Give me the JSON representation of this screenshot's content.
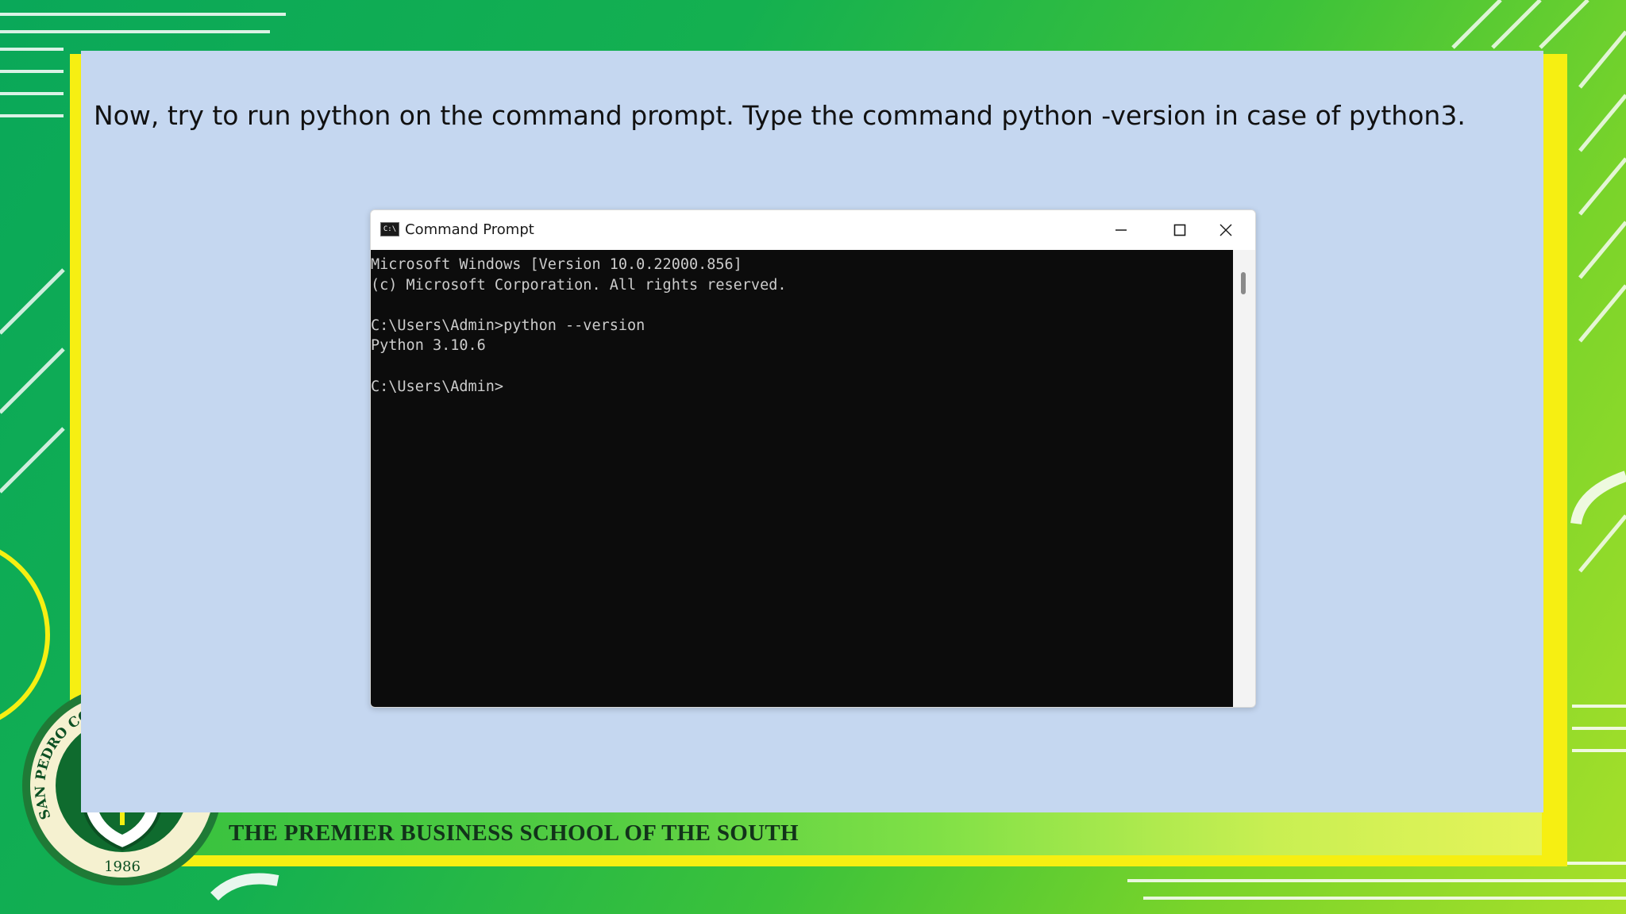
{
  "slide": {
    "instruction": "Now, try to run python on the command prompt. Type the command python -version in case of python3.",
    "tagline": "THE PREMIER BUSINESS SCHOOL OF THE SOUTH"
  },
  "seal": {
    "name": "SAN PEDRO COLLEGE",
    "year": "1986"
  },
  "window": {
    "title": "Command Prompt",
    "icon": "cmd-app-icon",
    "icon_glyph": "C:\\",
    "controls": [
      "minimize-icon",
      "maximize-icon",
      "close-icon"
    ]
  },
  "console": {
    "lines": [
      "Microsoft Windows [Version 10.0.22000.856]",
      "(c) Microsoft Corporation. All rights reserved.",
      "",
      "C:\\Users\\Admin>python --version",
      "Python 3.10.6",
      "",
      "C:\\Users\\Admin>"
    ]
  },
  "colors": {
    "background_green": "#14b050",
    "frame_yellow": "#f6ef12",
    "panel_blue": "#c5d7f0",
    "console_bg": "#0c0c0c",
    "console_text": "#cccccc",
    "seal_green": "#0f6b2e"
  }
}
